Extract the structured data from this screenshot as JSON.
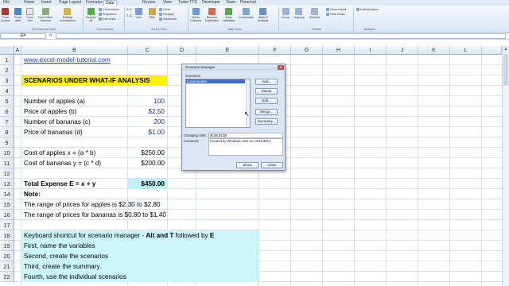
{
  "tabs": [
    "File",
    "Home",
    "Insert",
    "Page Layout",
    "Formulas",
    "Data",
    "Review",
    "View",
    "Turbo TTS",
    "Developer",
    "Team",
    "Personal"
  ],
  "active_tab": "Data",
  "ribbon": {
    "from_access": "From\nAccess",
    "from_web": "From\nWeb",
    "from_text": "From\nText",
    "from_other": "From Other\nSources",
    "existing": "Existing\nConnections",
    "refresh_all": "Refresh\nAll",
    "connections": "Connections",
    "properties": "Properties",
    "edit_links": "Edit Links",
    "sort_az": "A↓Z",
    "sort_za": "Z↓A",
    "sort": "Sort",
    "filter": "Filter",
    "clear": "Clear",
    "reapply": "Reapply",
    "advanced": "Advanced",
    "text_to_columns": "Text to\nColumns",
    "remove_duplicates": "Remove\nDuplicates",
    "data_validation": "Data\nValidation",
    "consolidate": "Consolidate",
    "what_if": "What-If\nAnalysis",
    "group": "Group",
    "ungroup": "Ungroup",
    "subtotal": "Subtotal",
    "show_detail": "Show Detail",
    "hide_detail": "Hide Detail",
    "data_analysis": "Data Analysis",
    "group_labels": [
      "Get External Data",
      "Connections",
      "Sort & Filter",
      "Data Tools",
      "Outline",
      "Analysis"
    ]
  },
  "formula_bar": {
    "name_box": "E4",
    "fx": "fx",
    "content": ""
  },
  "columns": [
    "A",
    "B",
    "C",
    "D",
    "E",
    "F",
    "G",
    "H",
    "I",
    "J",
    "K",
    "L"
  ],
  "rows": [
    "1",
    "2",
    "3",
    "4",
    "5",
    "6",
    "7",
    "8",
    "9",
    "10",
    "11",
    "12",
    "13",
    "14",
    "15",
    "16",
    "17",
    "18",
    "19",
    "20",
    "21",
    "22"
  ],
  "cells": {
    "b1": "www.excel-model-tutorial.com",
    "b3": "SCENARIOS UNDER WHAT-IF ANALYSIS",
    "b5": "Number of apples (a)",
    "c5": "100",
    "b6": "Price of apples (b)",
    "c6": "$2.50",
    "b7": "Number of bananas (c)",
    "c7": "200",
    "b8": "Price of bananas (d)",
    "c8": "$1.00",
    "b10": "Cost of apples x = (a * b)",
    "c10": "$250.00",
    "b11": "Cost of bananas y = (c * d)",
    "c11": "$200.00",
    "b13": "Total Expense E = x + y",
    "c13": "$450.00",
    "b14": "Note:",
    "b15": "The range of prices for apples is $2.30 to $2.80",
    "b16": "The range of prices for bananas is $0.80 to $1.40",
    "b18_a": "Keyboard shortcut for scenario manager - ",
    "b18_b": "Alt and T",
    "b18_c": " followed by ",
    "b18_d": "E",
    "b19": "First, name the variables",
    "b20": "Second, create the scenarios",
    "b21": "Third, create the summary",
    "b22": "Fourth, use the individual scenarios"
  },
  "dialog": {
    "title": "Scenario Manager",
    "close": "x",
    "scenarios_label": "Scenarios:",
    "scenarios": [
      "Conservative"
    ],
    "add": "Add...",
    "delete": "Delete",
    "edit": "Edit...",
    "merge": "Merge...",
    "summary": "Summary...",
    "changing_cells_label": "Changing cells:",
    "changing_cells": "$C$5,$C$8",
    "comment_label": "Comment:",
    "comment": "Created by Windows User on 10/11/2014",
    "show": "Show",
    "close_btn": "Close"
  },
  "colors": {
    "yellow": "#fff200",
    "cyan": "#bff3f7",
    "instr": "#cdf6fa",
    "ribbon": "#dfe9f5"
  }
}
